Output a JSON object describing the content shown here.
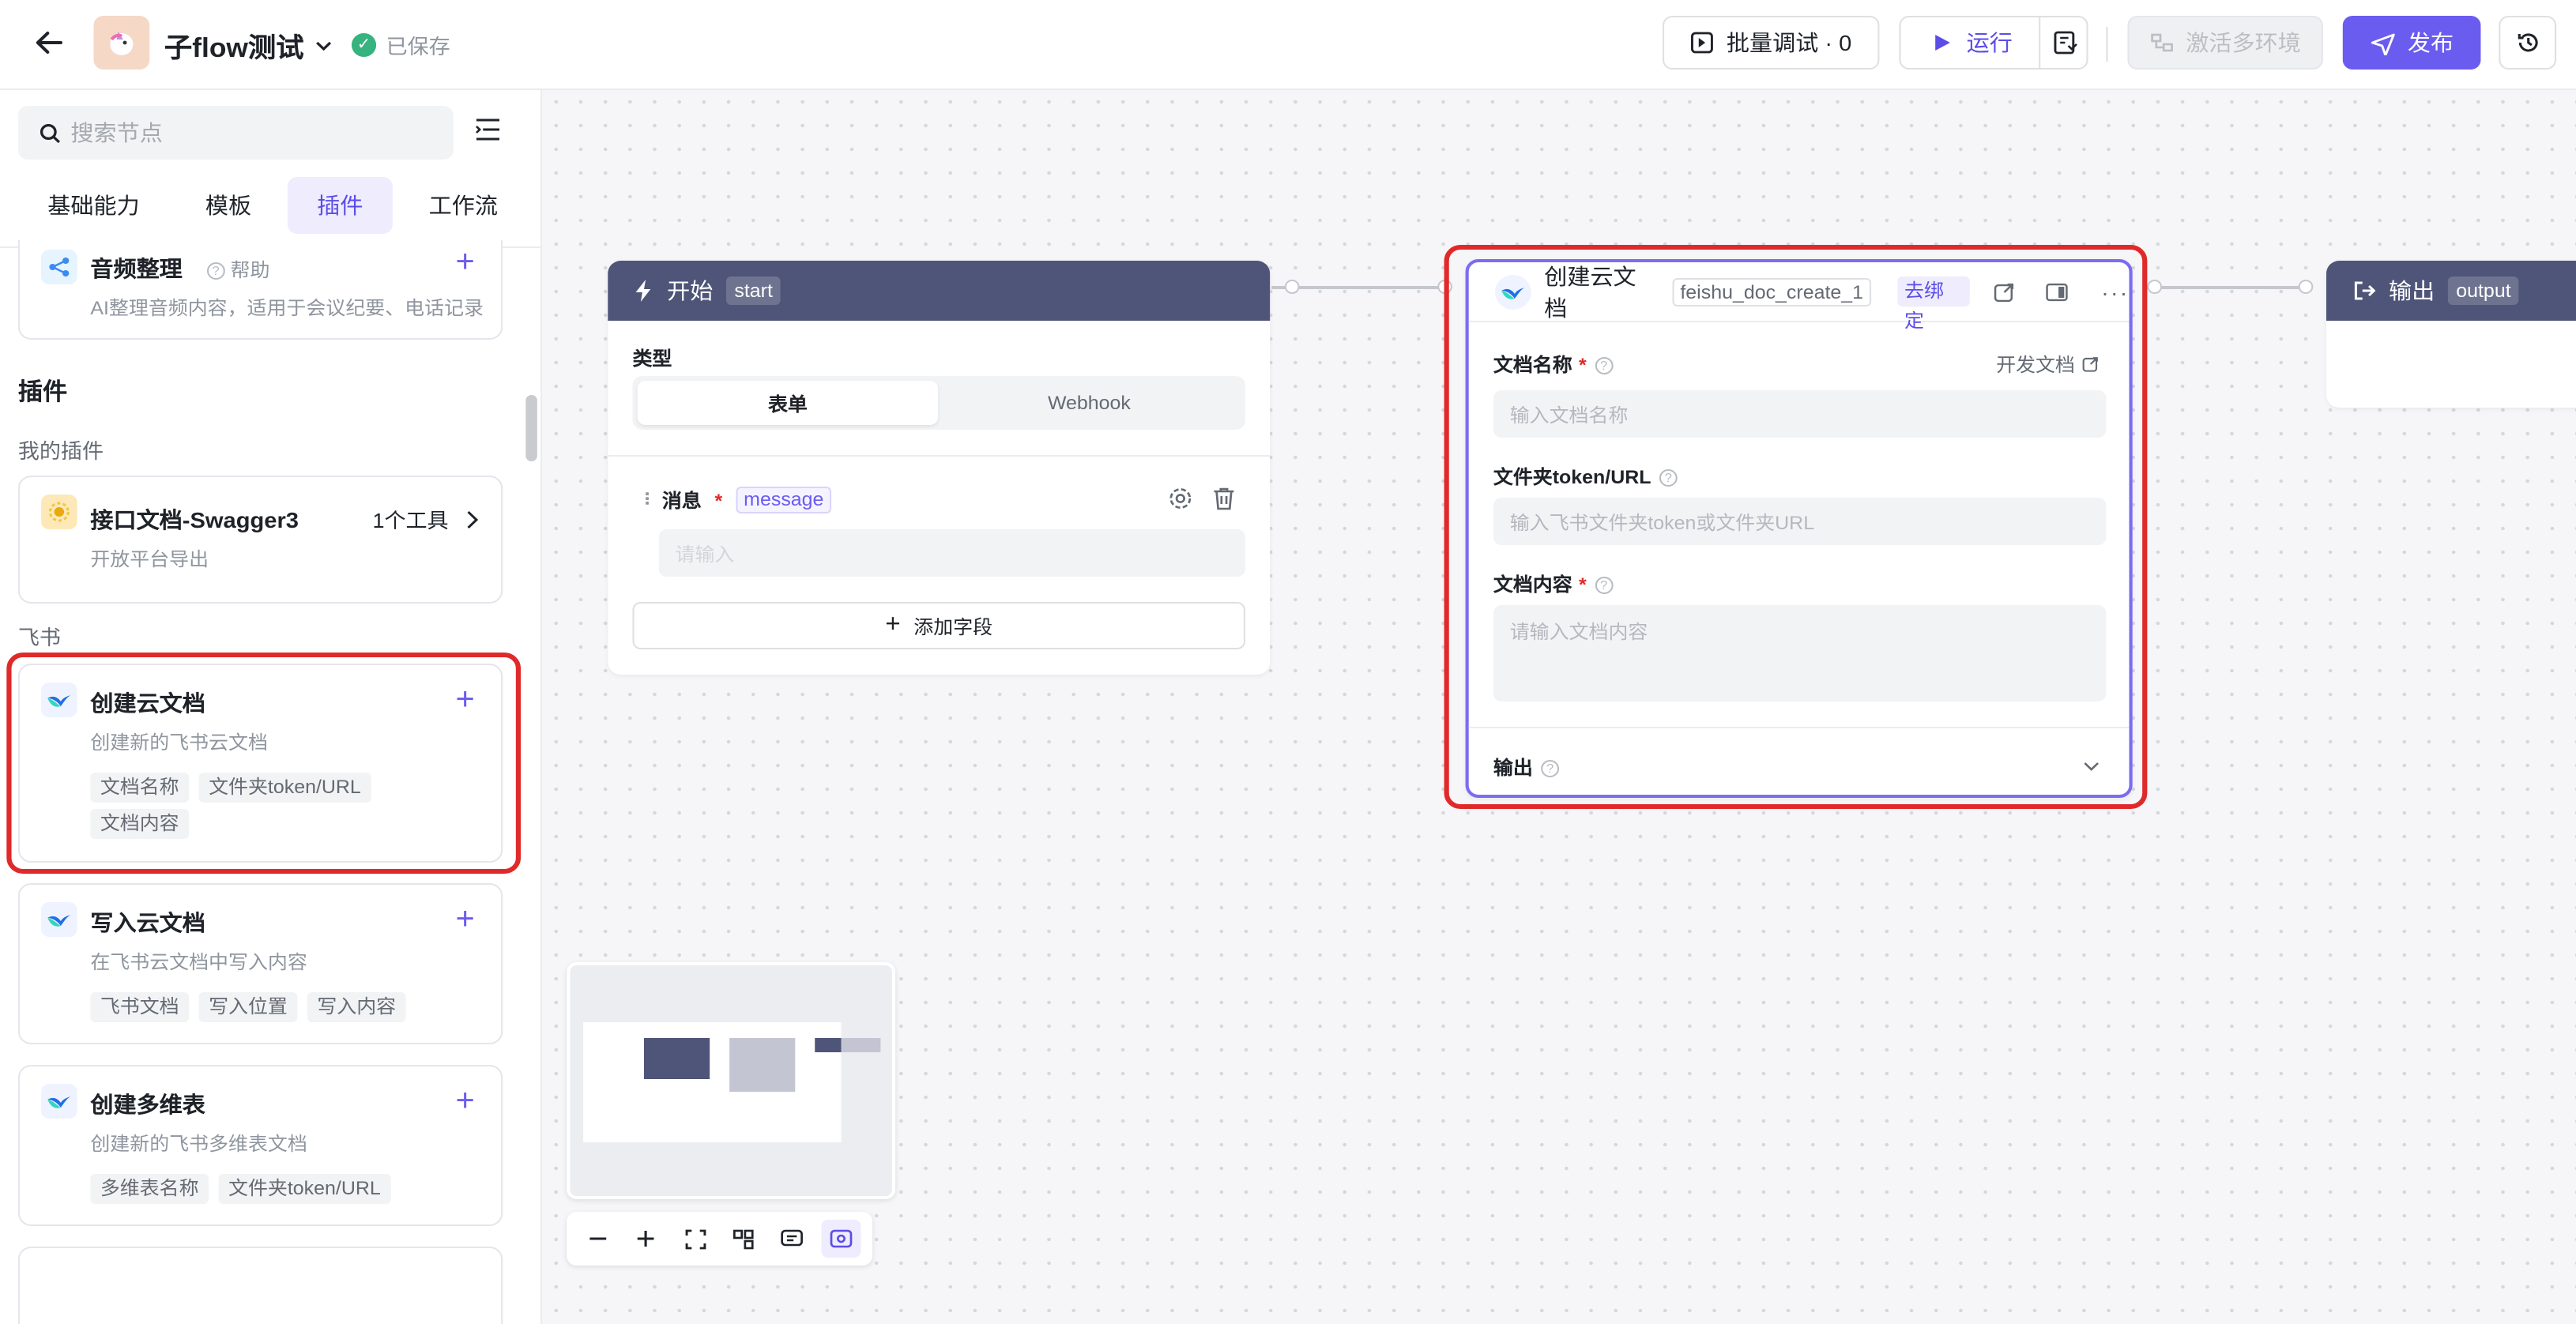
{
  "header": {
    "app_title": "子flow测试",
    "saved_label": "已保存",
    "batch_debug_label": "批量调试 · 0",
    "run_label": "运行",
    "activate_env_label": "激活多环境",
    "publish_label": "发布"
  },
  "sidebar": {
    "search_placeholder": "搜索节点",
    "tabs": [
      "基础能力",
      "模板",
      "插件",
      "工作流"
    ],
    "active_tab": "插件",
    "top_card": {
      "title": "音频整理",
      "help": "帮助",
      "desc": "AI整理音频内容，适用于会议纪要、电话记录"
    },
    "plugins_heading": "插件",
    "my_plugins_label": "我的插件",
    "swagger_card": {
      "title": "接口文档-Swagger3",
      "tool_count": "1个工具",
      "desc": "开放平台导出"
    },
    "feishu_label": "飞书",
    "feishu_cards": [
      {
        "title": "创建云文档",
        "desc": "创建新的飞书云文档",
        "tags": [
          "文档名称",
          "文件夹token/URL",
          "文档内容"
        ]
      },
      {
        "title": "写入云文档",
        "desc": "在飞书云文档中写入内容",
        "tags": [
          "飞书文档",
          "写入位置",
          "写入内容"
        ]
      },
      {
        "title": "创建多维表",
        "desc": "创建新的飞书多维表文档",
        "tags": [
          "多维表名称",
          "文件夹token/URL"
        ]
      }
    ]
  },
  "start_node": {
    "title": "开始",
    "code": "start",
    "type_label": "类型",
    "type_options": [
      "表单",
      "Webhook"
    ],
    "selected_type": "表单",
    "field_label": "消息",
    "field_key": "message",
    "field_placeholder": "请输入",
    "add_field_label": "添加字段"
  },
  "doc_node": {
    "title": "创建云文档",
    "code": "feishu_doc_create_1",
    "unbind_label": "去绑定",
    "dev_doc_label": "开发文档",
    "name_label": "文档名称",
    "name_placeholder": "输入文档名称",
    "folder_label": "文件夹token/URL",
    "folder_placeholder": "输入飞书文件夹token或文件夹URL",
    "content_label": "文档内容",
    "content_placeholder": "请输入文档内容",
    "output_label": "输出"
  },
  "output_node": {
    "title": "输出",
    "code": "output"
  },
  "colors": {
    "accent": "#6b5cf0",
    "node_header": "#4f5578",
    "highlight": "#e02a2a",
    "saved": "#36b37e"
  }
}
